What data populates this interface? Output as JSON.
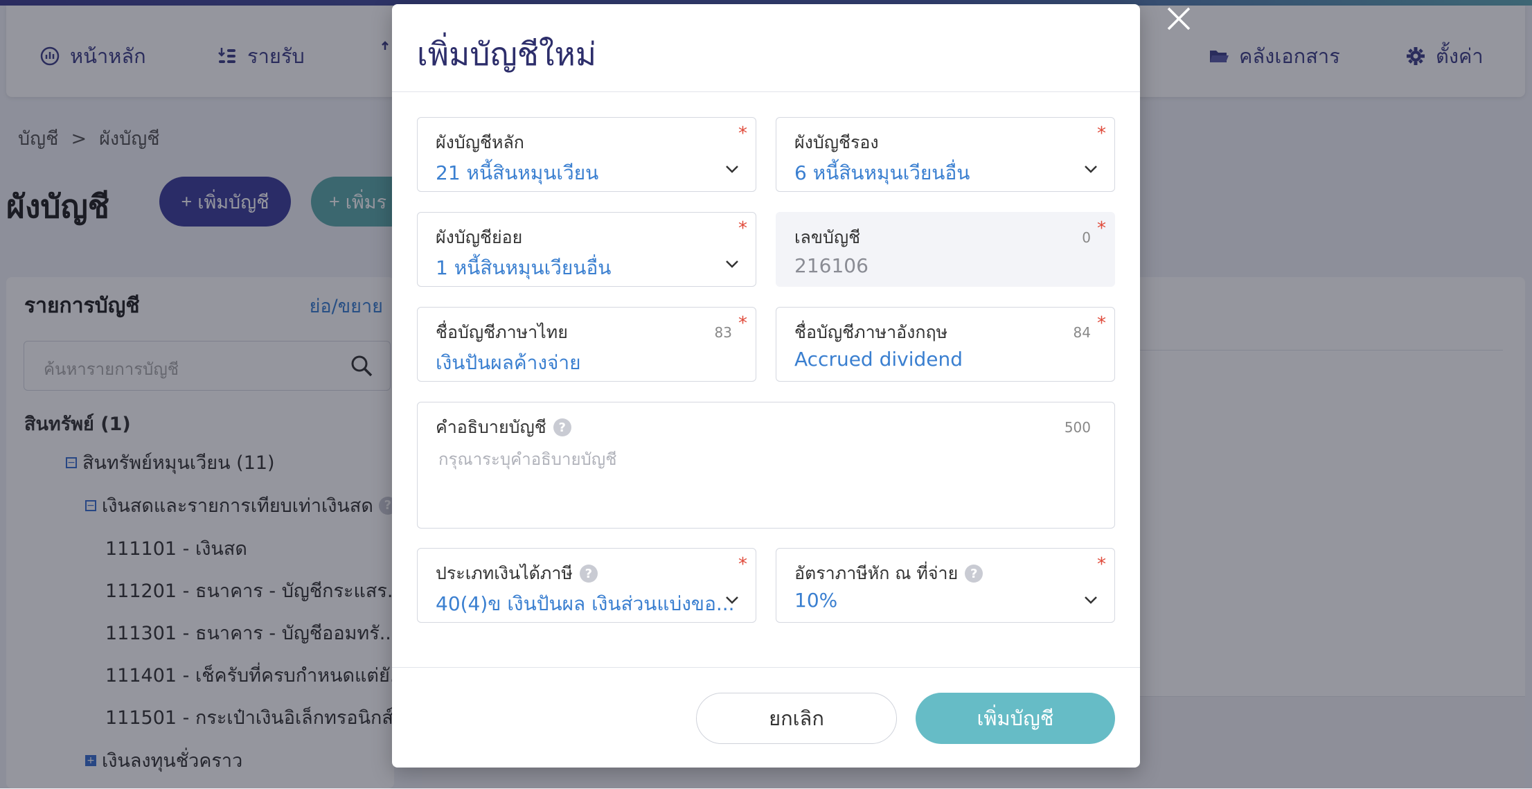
{
  "nav": {
    "items": [
      {
        "label": "หน้าหลัก",
        "icon": "dashboard-icon"
      },
      {
        "label": "รายรับ",
        "icon": "income-icon"
      },
      {
        "label": "",
        "icon": "expense-icon"
      },
      {
        "label": "คลังเอกสาร",
        "icon": "folder-icon"
      },
      {
        "label": "ตั้งค่า",
        "icon": "gear-icon"
      }
    ]
  },
  "breadcrumb": {
    "root": "บัญชี",
    "sep": ">",
    "current": "ผังบัญชี"
  },
  "page": {
    "title": "ผังบัญชี",
    "add_account_label": "เพิ่มบัญชี",
    "add_other_label": "เพิ่มร"
  },
  "sidebar": {
    "title": "รายการบัญชี",
    "toggle": "ย่อ/ขยาย",
    "search_placeholder": "ค้นหารายการบัญชี",
    "tree": [
      {
        "label": "สินทรัพย์ (1)"
      },
      {
        "label": "สินทรัพย์หมุนเวียน (11)"
      },
      {
        "label": "เงินสดและรายการเทียบเท่าเงินสด"
      },
      {
        "label": "111101 - เงินสด"
      },
      {
        "label": "111201 - ธนาคาร - บัญชีกระแสร..."
      },
      {
        "label": "111301 - ธนาคาร - บัญชีออมทรั..."
      },
      {
        "label": "111401 - เช็ครับที่ครบกำหนดแต่ยั..."
      },
      {
        "label": "111501 - กระเป๋าเงินอิเล็กทรอนิกส์"
      },
      {
        "label": "เงินลงทุนชั่วคราว"
      }
    ]
  },
  "modal": {
    "title": "เพิ่มบัญชีใหม่",
    "required_mark": "*",
    "fields": {
      "main_chart": {
        "label": "ผังบัญชีหลัก",
        "value": "21 หนี้สินหมุนเวียน"
      },
      "sub_chart": {
        "label": "ผังบัญชีรอง",
        "value": "6 หนี้สินหมุนเวียนอื่น"
      },
      "minor_chart": {
        "label": "ผังบัญชีย่อย",
        "value": "1 หนี้สินหมุนเวียนอื่น"
      },
      "account_no": {
        "label": "เลขบัญชี",
        "value": "216106",
        "count": "0"
      },
      "name_th": {
        "label": "ชื่อบัญชีภาษาไทย",
        "value": "เงินปันผลค้างจ่าย",
        "count": "83"
      },
      "name_en": {
        "label": "ชื่อบัญชีภาษาอังกฤษ",
        "value": "Accrued dividend",
        "count": "84"
      },
      "description": {
        "label": "คำอธิบายบัญชี",
        "placeholder": "กรุณาระบุคำอธิบายบัญชี",
        "count": "500"
      },
      "income_type": {
        "label": "ประเภทเงินได้ภาษี",
        "value": "40(4)ข เงินปันผล เงินส่วนแบ่งขอ..."
      },
      "wht_rate": {
        "label": "อัตราภาษีหัก ณ ที่จ่าย",
        "value": "10%"
      }
    },
    "help_glyph": "?",
    "cancel_label": "ยกเลิก",
    "submit_label": "เพิ่มบัญชี"
  },
  "colors": {
    "primary": "#3d3e9b",
    "teal": "#66bcc6",
    "link": "#3a7fd0",
    "required": "#e04a3a"
  }
}
